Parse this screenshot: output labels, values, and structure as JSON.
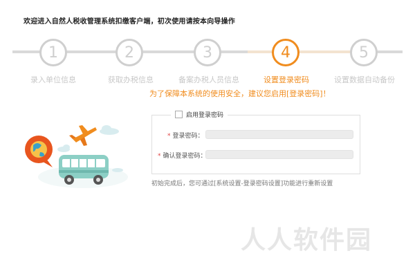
{
  "header": {
    "title": "欢迎进入自然人税收管理系统扣缴客户端，初次使用请按本向导操作"
  },
  "steps": [
    {
      "num": "1",
      "label": "录入单位信息",
      "active": false
    },
    {
      "num": "2",
      "label": "获取办税信息",
      "active": false
    },
    {
      "num": "3",
      "label": "备案办税人员信息",
      "active": false
    },
    {
      "num": "4",
      "label": "设置登录密码",
      "active": true
    },
    {
      "num": "5",
      "label": "设置数据自动备份",
      "active": false
    }
  ],
  "hint": "为了保障本系统的使用安全，建议您启用[登录密码]！",
  "form": {
    "enable_label": "启用登录密码",
    "password_label": "登录密码：",
    "confirm_label": "确认登录密码：",
    "password_value": "",
    "confirm_value": ""
  },
  "footnote": "初始完成后，您可通过[系统设置-登录密码设置]功能进行重新设置",
  "watermark": "人人软件园",
  "colors": {
    "accent": "#f08c1e",
    "inactive": "#cfcfcf",
    "required": "#e04040"
  }
}
